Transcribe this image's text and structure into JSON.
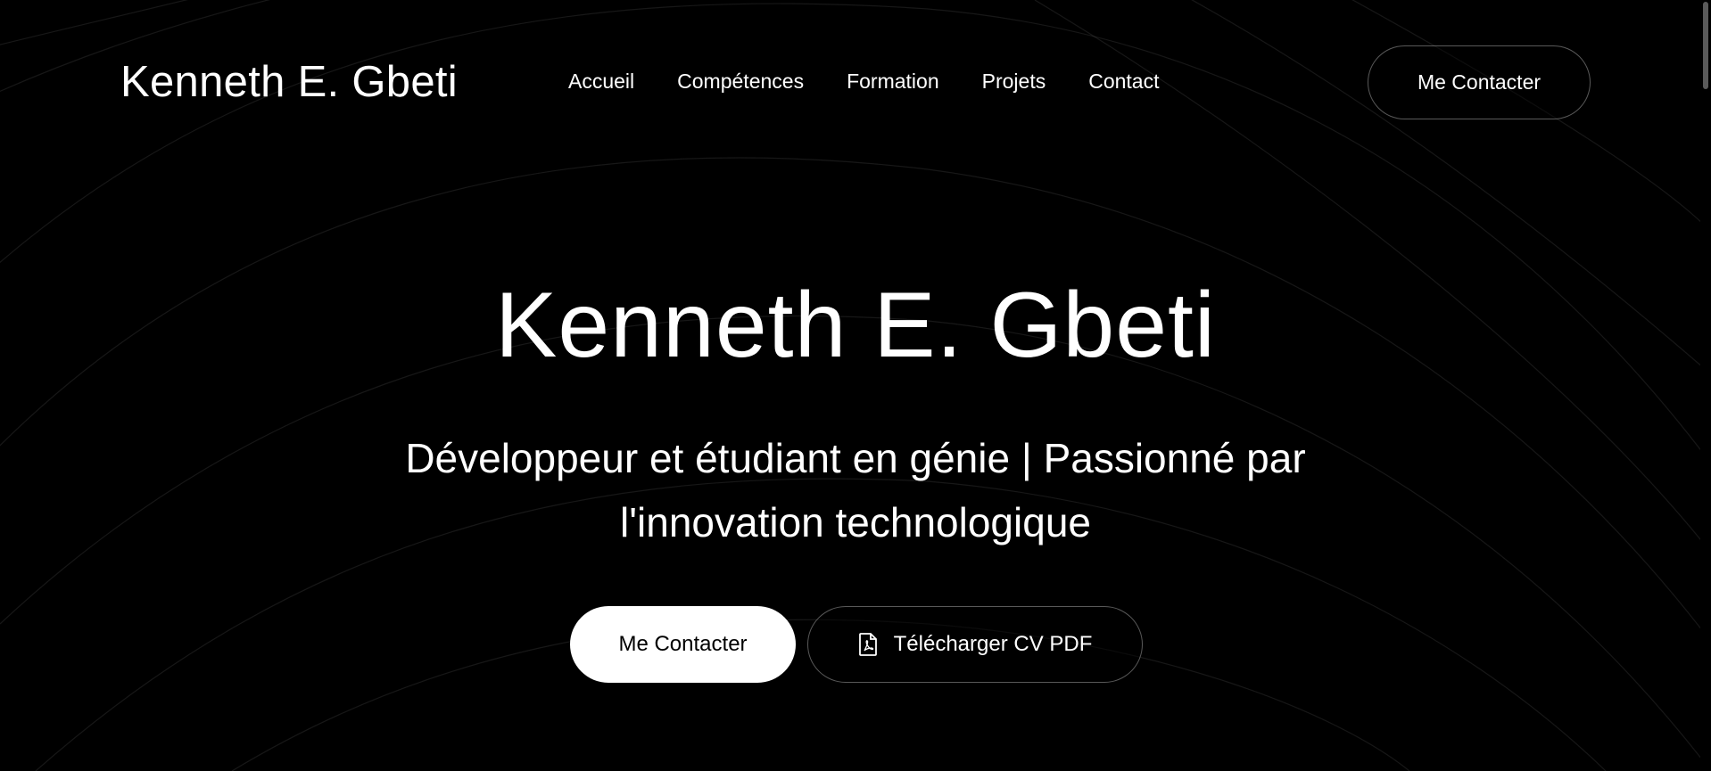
{
  "header": {
    "logo": "Kenneth E. Gbeti",
    "nav": [
      {
        "label": "Accueil"
      },
      {
        "label": "Compétences"
      },
      {
        "label": "Formation"
      },
      {
        "label": "Projets"
      },
      {
        "label": "Contact"
      }
    ],
    "cta_label": "Me Contacter"
  },
  "hero": {
    "title": "Kenneth E. Gbeti",
    "subtitle": "Développeur et étudiant en génie | Passionné par l'innovation technologique",
    "primary_button": "Me Contacter",
    "secondary_button": "Télécharger CV PDF",
    "secondary_button_icon": "pdf-file-icon"
  },
  "theme": {
    "background": "#000000",
    "text": "#ffffff",
    "primary_button_bg": "#ffffff",
    "primary_button_text": "#000000"
  }
}
